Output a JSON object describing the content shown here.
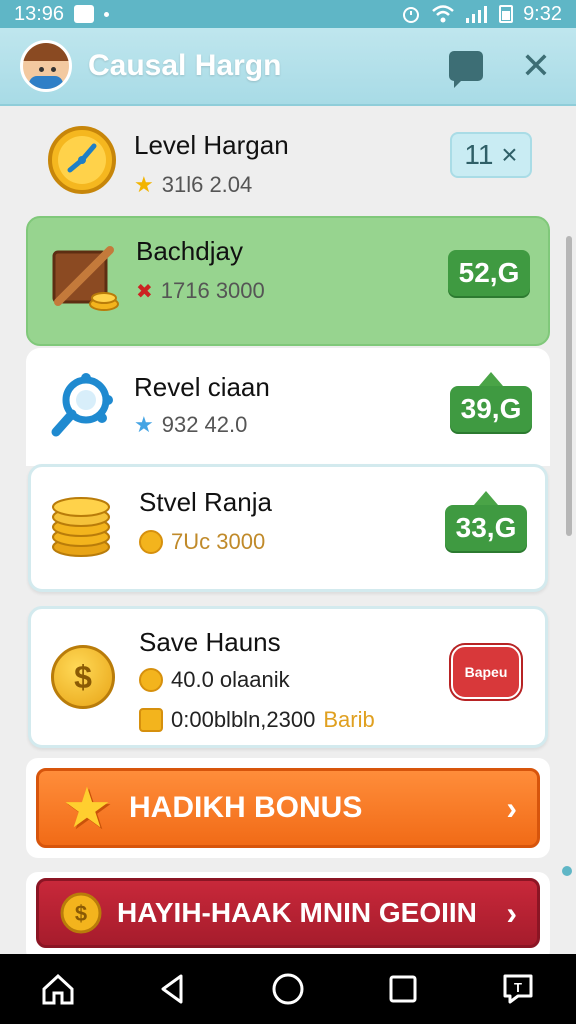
{
  "status_bar": {
    "time_left": "13:96",
    "time_right": "9:32"
  },
  "app_bar": {
    "title": "Causal Hargn"
  },
  "cards": [
    {
      "title": "Level Hargan",
      "sub": "31l6 2.04",
      "badge": "11 ×"
    },
    {
      "title": "Bachdjay",
      "sub": "1716 3000",
      "badge": "52,G"
    },
    {
      "title": "Revel ciaan",
      "sub": "932 42.0",
      "badge": "39,G"
    },
    {
      "title": "Stvel Ranja",
      "sub": "7Uc 3000",
      "badge": "33,G"
    },
    {
      "title": "Save Hauns",
      "line1": "40.0 olaanik",
      "line2_a": "0:00blbln,2300",
      "line2_b": "Barib",
      "seal": "Bapeu"
    }
  ],
  "buttons": {
    "bonus": "HADIKH BONUS",
    "red": "HAYIH-HAAK MNIN GEOIIN",
    "chevron": "›"
  },
  "colors": {
    "accent": "#5fb6c6",
    "green_card": "#97d48f",
    "badge_green": "#3f9a41",
    "orange": "#f16b17",
    "red": "#b31f30"
  }
}
